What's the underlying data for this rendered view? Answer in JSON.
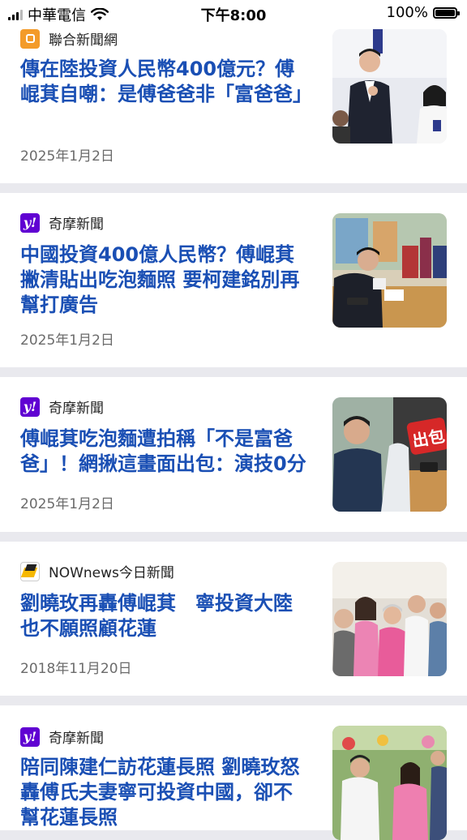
{
  "status_bar": {
    "carrier": "中華電信",
    "time": "下午8:00",
    "battery": "100%",
    "battery_level": 1.0
  },
  "articles": [
    {
      "source": "聯合新聞網",
      "source_icon": "udn-logo-icon",
      "title": "傳在陸投資人民幣400億元？傅崐萁自嘲：是傅爸爸非「富爸爸」",
      "date": "2025年1月2日",
      "thumbnail": "news-photo-fu-applause"
    },
    {
      "source": "奇摩新聞",
      "source_icon": "yahoo-logo-icon",
      "title": "中國投資400億人民幣？傅崐萁撇清貼出吃泡麵照 要柯建銘別再幫打廣告",
      "date": "2025年1月2日",
      "thumbnail": "news-photo-fu-noodles"
    },
    {
      "source": "奇摩新聞",
      "source_icon": "yahoo-logo-icon",
      "title": "傅崐萁吃泡麵遭拍稱「不是富爸爸」！網揪這畫面出包：演技0分",
      "date": "2025年1月2日",
      "thumbnail": "news-photo-collage",
      "thumbnail_text": "出包"
    },
    {
      "source": "NOWnews今日新聞",
      "source_icon": "nownews-logo-icon",
      "title": "劉曉玫再轟傅崐萁　寧投資大陸也不願照顧花蓮",
      "date": "2018年11月20日",
      "thumbnail": "news-photo-group-seated"
    },
    {
      "source": "奇摩新聞",
      "source_icon": "yahoo-logo-icon",
      "title": "陪同陳建仁訪花蓮長照 劉曉玫怒轟傅氏夫妻寧可投資中國，卻不幫花蓮長照",
      "date": "",
      "thumbnail": "news-photo-event"
    }
  ],
  "colors": {
    "headline": "#1a4fb4",
    "separator": "#e9e9ee",
    "yahoo": "#6001d2",
    "udn": "#f39b2a"
  }
}
